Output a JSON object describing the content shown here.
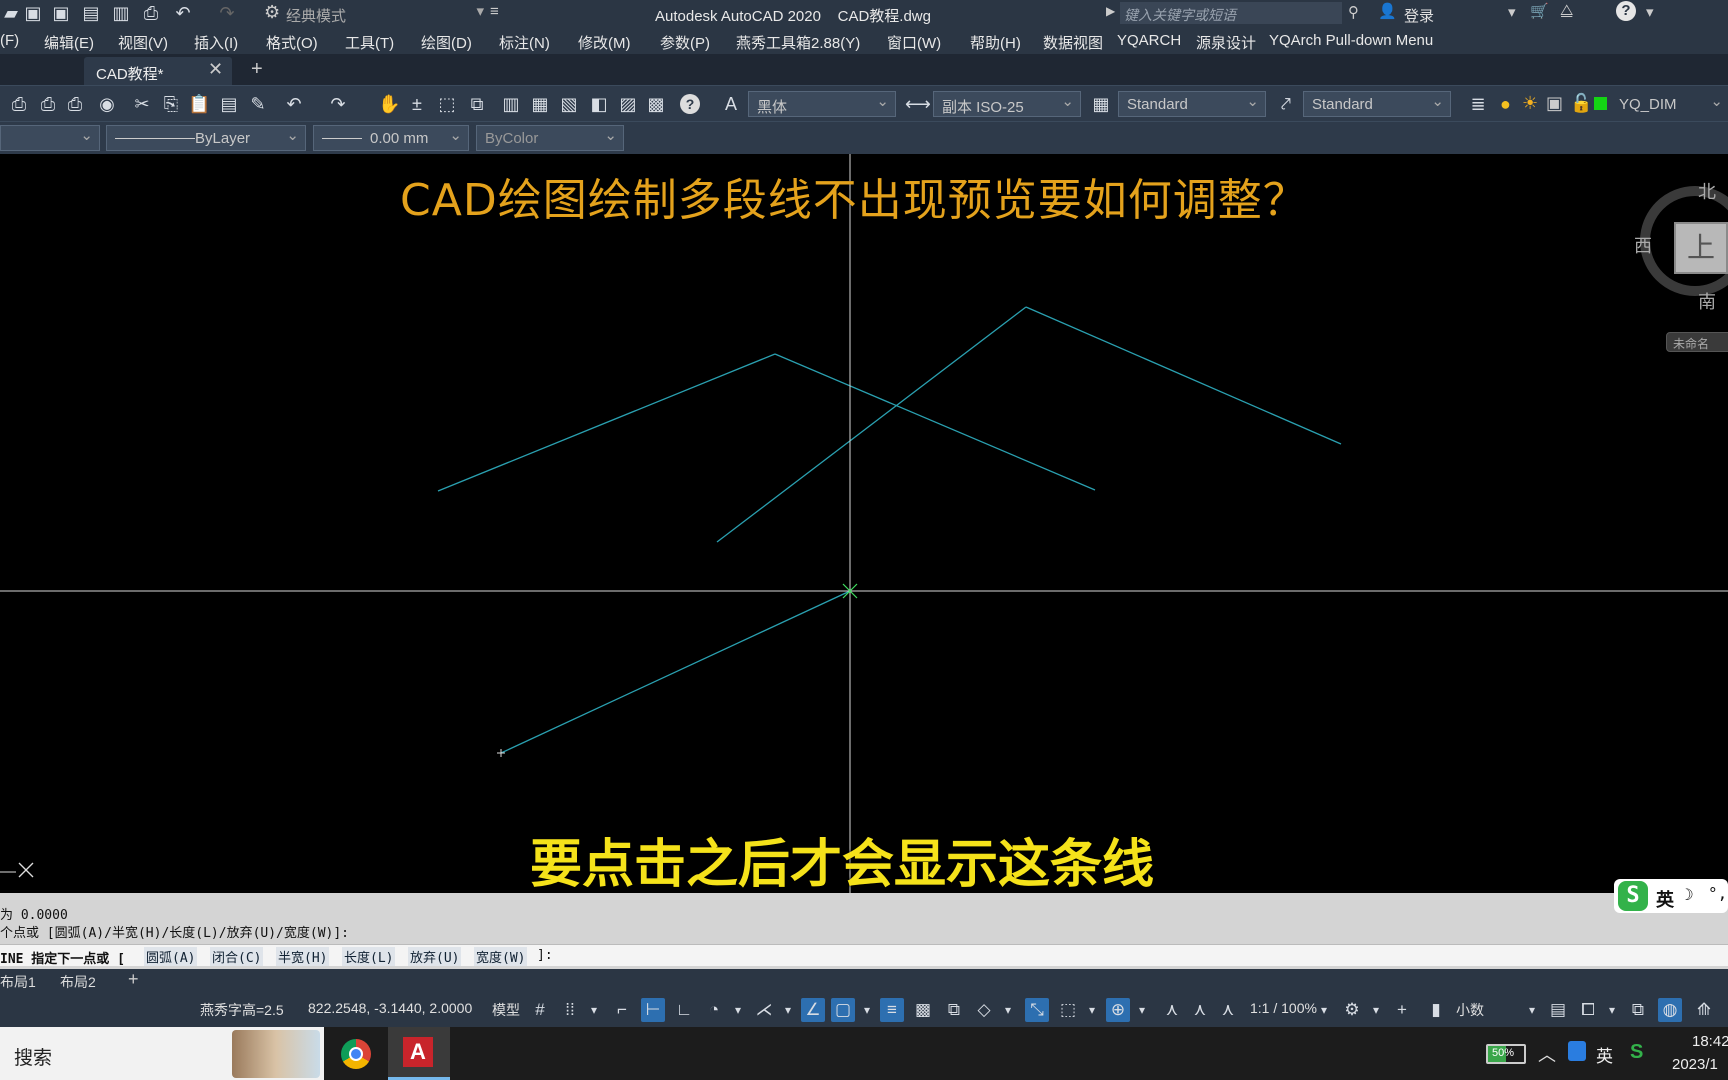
{
  "titlebar": {
    "workspace": "经典模式",
    "title": "Autodesk AutoCAD 2020    CAD教程.dwg",
    "search_placeholder": "键入关键字或短语",
    "login": "登录"
  },
  "menubar": {
    "items": [
      "(F)",
      "编辑(E)",
      "视图(V)",
      "插入(I)",
      "格式(O)",
      "工具(T)",
      "绘图(D)",
      "标注(N)",
      "修改(M)",
      "参数(P)",
      "燕秀工具箱2.88(Y)",
      "窗口(W)",
      "帮助(H)",
      "数据视图",
      "YQARCH",
      "源泉设计",
      "YQArch Pull-down Menu"
    ]
  },
  "tabs": {
    "active": "CAD教程*"
  },
  "toolbar1": {
    "text_style": "黑体",
    "dim_style": "副本 ISO-25",
    "table_style": "Standard",
    "mleader_style": "Standard",
    "layer": "YQ_DIM"
  },
  "toolbar2": {
    "linetype": "ByLayer",
    "lineweight": "0.00 mm",
    "plotstyle": "ByColor"
  },
  "canvas": {
    "overlay_title": "CAD绘图绘制多段线不出现预览要如何调整？",
    "subtitle": "要点击之后才会显示这条线",
    "viewcube": {
      "north": "北",
      "south": "南",
      "west": "西",
      "top": "上",
      "wcs": "未命名"
    }
  },
  "command": {
    "line1": "为 0.0000",
    "line2": "个点或 [圆弧(A)/半宽(H)/长度(L)/放弃(U)/宽度(W)]:",
    "prompt_prefix": "INE 指定下一点或 [",
    "options": [
      "圆弧(A)",
      "闭合(C)",
      "半宽(H)",
      "长度(L)",
      "放弃(U)",
      "宽度(W)"
    ],
    "prompt_suffix": "]:"
  },
  "layouts": {
    "tabs": [
      "布局1",
      "布局2"
    ]
  },
  "status": {
    "text_height": "燕秀字高=2.5",
    "coords": "822.2548, -3.1440, 2.0000",
    "model": "模型",
    "scale": "1:1 / 100%",
    "units": "小数"
  },
  "ime": {
    "lang": "英"
  },
  "taskbar": {
    "search": "搜索",
    "battery": "50%",
    "lang": "英",
    "time": "18:42",
    "date": "2023/1"
  }
}
